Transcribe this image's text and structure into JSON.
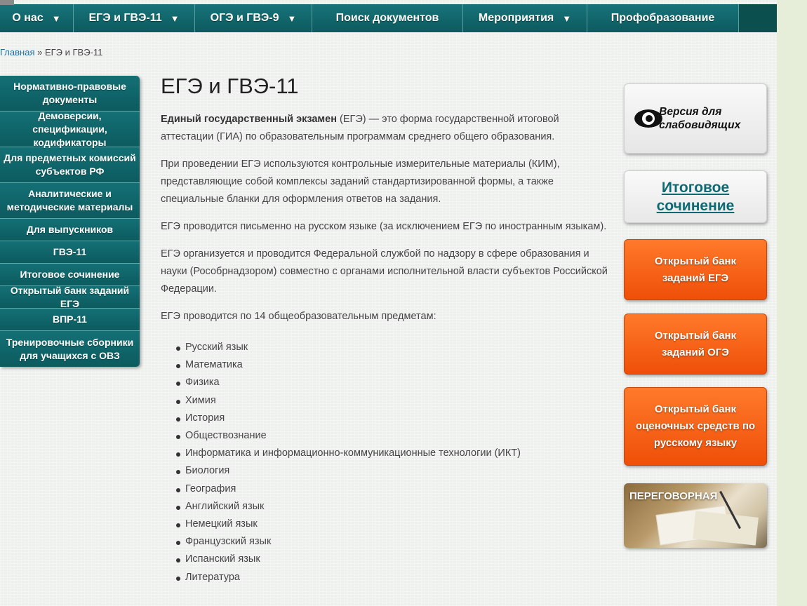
{
  "nav": {
    "items": [
      {
        "label": "О нас",
        "caret": "▼"
      },
      {
        "label": "ЕГЭ и ГВЭ-11",
        "caret": "▼"
      },
      {
        "label": "ОГЭ и ГВЭ-9",
        "caret": "▼"
      },
      {
        "label": "Поиск документов"
      },
      {
        "label": "Мероприятия",
        "caret": "▼"
      },
      {
        "label": "Профобразование"
      }
    ]
  },
  "breadcrumb": {
    "home": "Главная",
    "separator": "»",
    "current": "ЕГЭ и ГВЭ-11"
  },
  "sidebar": {
    "items": [
      "Нормативно-правовые документы",
      "Демоверсии, спецификации, кодификаторы",
      "Для предметных комиссий субъектов РФ",
      "Аналитические и методические материалы",
      "Для выпускников",
      "ГВЭ-11",
      "Итоговое сочинение",
      "Открытый банк заданий ЕГЭ",
      "ВПР-11",
      "Тренировочные сборники для учащихся с ОВЗ"
    ]
  },
  "main": {
    "title": "ЕГЭ и ГВЭ-11",
    "intro_bold": "Единый государственный экзамен",
    "intro_rest": " (ЕГЭ) — это форма государственной итоговой аттестации (ГИА) по образовательным программам среднего общего образования.",
    "para2": "При проведении ЕГЭ используются контрольные измерительные материалы (КИМ), представляющие собой комплексы заданий стандартизированной формы, а также специальные бланки для оформления ответов на задания.",
    "para3": "ЕГЭ проводится письменно на русском языке (за исключением ЕГЭ по иностранным языкам).",
    "para4": "ЕГЭ организуется и проводится Федеральной службой по надзору в сфере образования и науки (Рособрнадзором) совместно с органами исполнительной власти субъектов Российской Федерации.",
    "para5": "ЕГЭ проводится по 14 общеобразовательным предметам:",
    "subjects": [
      "Русский язык",
      "Математика",
      "Физика",
      "Химия",
      "История",
      "Обществознание",
      "Информатика и информационно-коммуникационные технологии (ИКТ)",
      "Биология",
      "География",
      "Английский язык",
      "Немецкий язык",
      "Французский язык",
      "Испанский язык",
      "Литература"
    ]
  },
  "right": {
    "eye_icon": "eye-icon",
    "low_vision": "Версия для слабовидящих",
    "essay": "Итоговое сочинение",
    "bank_ege": "Открытый банк заданий ЕГЭ",
    "bank_oge": "Открытый банк заданий ОГЭ",
    "bank_rus": "Открытый банк оценочных средств по русскому языку",
    "negotiation": "ПЕРЕГОВОРНАЯ"
  },
  "colors": {
    "nav_teal": "#0f5f63",
    "orange": "#f4600f",
    "essay_link": "#0d6a73"
  }
}
